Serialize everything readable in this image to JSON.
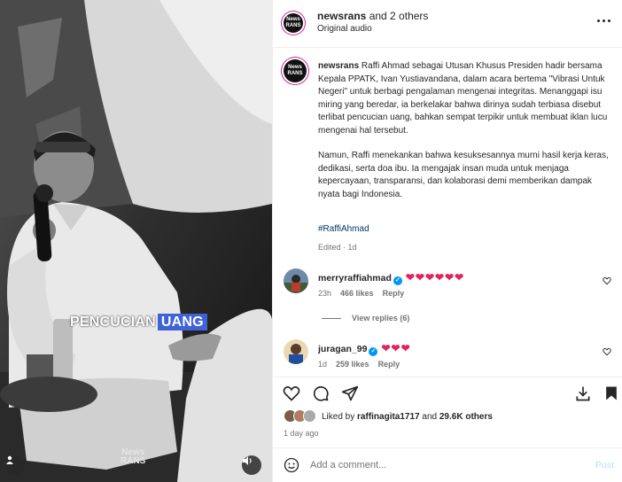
{
  "media": {
    "caption_word1": "PENCUCIAN",
    "caption_word2": "UANG",
    "watermark_line1": "News",
    "watermark_line2": "RANS",
    "caption_highlight_color": "#3f63d7"
  },
  "header": {
    "username": "newsrans",
    "others": " and 2 others",
    "audio": "Original audio",
    "avatar_text": "News RANS"
  },
  "post": {
    "username": "newsrans",
    "paragraph1": " Raffi Ahmad sebagai Utusan Khusus Presiden hadir bersama Kepala PPATK, Ivan Yustiavandana, dalam acara bertema \"Vibrasi Untuk Negeri\" untuk berbagi pengalaman mengenai integritas. Menanggapi isu miring yang beredar, ia berkelakar bahwa dirinya sudah terbiasa disebut terlibat pencucian uang, bahkan sempat terpikir untuk membuat iklan lucu mengenai hal tersebut.",
    "paragraph2": "Namun, Raffi menekankan bahwa kesuksesannya murni hasil kerja keras, dedikasi, serta doa ibu. Ia mengajak insan muda untuk menjaga kepercayaan, transparansi, dan kolaborasi demi memberikan dampak nyata bagi Indonesia.",
    "hashtag": "#RaffiAhmad",
    "edited": "Edited · 1d"
  },
  "comments": [
    {
      "username": "merryraffiahmad",
      "hearts": "❤❤❤❤❤❤",
      "time": "23h",
      "likes": "466 likes",
      "reply": "Reply"
    },
    {
      "username": "juragan_99",
      "hearts": "❤❤❤",
      "time": "1d",
      "likes": "259 likes",
      "reply": "Reply"
    }
  ],
  "view_replies": "View replies (6)",
  "liked_by": {
    "prefix": "Liked by ",
    "user": "raffinagita1717",
    "middle": " and ",
    "others": "29.6K others"
  },
  "time_ago": "1 day ago",
  "add_comment": {
    "placeholder": "Add a comment...",
    "post_label": "Post"
  },
  "icons": {
    "like": "heart-icon",
    "comment": "comment-icon",
    "share": "send-icon",
    "save": "bookmark-icon",
    "more": "more-icon",
    "emoji": "emoji-icon",
    "sound": "speaker-icon",
    "user": "user-icon"
  },
  "colors": {
    "verified": "#0095f6",
    "heart": "#e0245e",
    "link": "#00376b",
    "post_button": "#b2dffc"
  }
}
